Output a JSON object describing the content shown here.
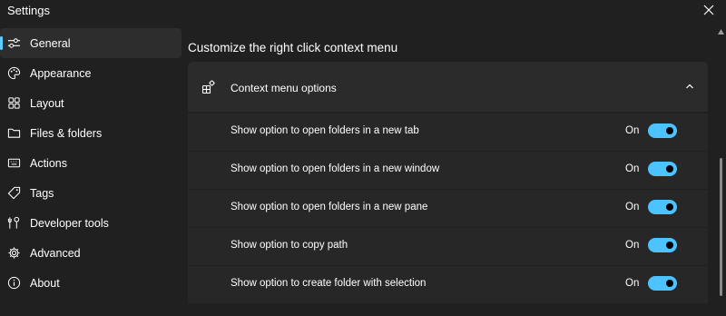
{
  "app": {
    "title": "Settings"
  },
  "sidebar": {
    "items": [
      {
        "label": "General",
        "icon": "sliders-icon",
        "active": true
      },
      {
        "label": "Appearance",
        "icon": "palette-icon"
      },
      {
        "label": "Layout",
        "icon": "grid-icon"
      },
      {
        "label": "Files & folders",
        "icon": "folder-icon"
      },
      {
        "label": "Actions",
        "icon": "keyboard-icon"
      },
      {
        "label": "Tags",
        "icon": "tag-icon"
      },
      {
        "label": "Developer tools",
        "icon": "wrench-icon"
      },
      {
        "label": "Advanced",
        "icon": "advanced-settings-icon"
      },
      {
        "label": "About",
        "icon": "info-icon"
      }
    ]
  },
  "main": {
    "heading": "Customize the right click context menu",
    "expander": {
      "title": "Context menu options",
      "icon": "apps-add-icon",
      "expanded": true,
      "rows": [
        {
          "label": "Show option to open folders in a new tab",
          "state": "On",
          "on": true
        },
        {
          "label": "Show option to open folders in a new window",
          "state": "On",
          "on": true
        },
        {
          "label": "Show option to open folders in a new pane",
          "state": "On",
          "on": true
        },
        {
          "label": "Show option to copy path",
          "state": "On",
          "on": true
        },
        {
          "label": "Show option to create folder with selection",
          "state": "On",
          "on": true
        }
      ]
    }
  },
  "colors": {
    "accent": "#4cc2ff",
    "background": "#202020",
    "card": "#2b2b2b"
  }
}
